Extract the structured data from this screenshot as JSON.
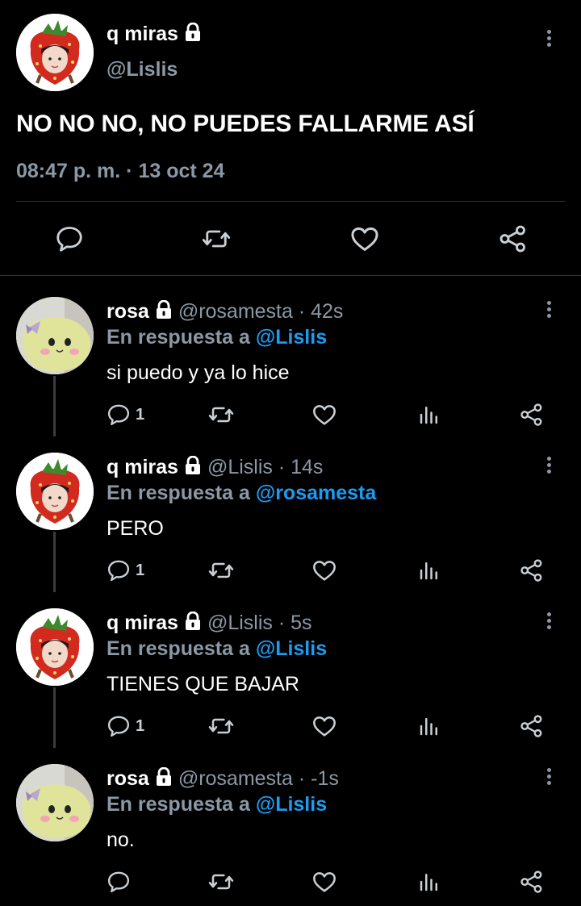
{
  "main_tweet": {
    "name": "q miras",
    "handle": "@Lislis",
    "text": "NO NO NO, NO PUEDES FALLARME ASÍ",
    "timestamp": "08:47 p. m. · 13 oct 24",
    "icons": [
      "lock-icon",
      "more-icon",
      "reply-icon",
      "retweet-icon",
      "like-icon",
      "share-icon"
    ]
  },
  "replies": [
    {
      "name": "rosa",
      "handle": "@rosamesta · 42s",
      "in_reply_label": "En respuesta a",
      "in_reply_to": "@Lislis",
      "text": "si puedo y ya lo hice",
      "reply_count": "1",
      "avatar": "plush"
    },
    {
      "name": "q miras",
      "handle": "@Lislis · 14s",
      "in_reply_label": "En respuesta a",
      "in_reply_to": "@rosamesta",
      "text": "PERO",
      "reply_count": "1",
      "avatar": "strawberry"
    },
    {
      "name": "q miras",
      "handle": "@Lislis · 5s",
      "in_reply_label": "En respuesta a",
      "in_reply_to": "@Lislis",
      "text": "TIENES QUE BAJAR",
      "reply_count": "1",
      "avatar": "strawberry"
    },
    {
      "name": "rosa",
      "handle": "@rosamesta · -1s",
      "in_reply_label": "En respuesta a",
      "in_reply_to": "@Lislis",
      "text": "no.",
      "reply_count": "",
      "avatar": "plush"
    }
  ],
  "colors": {
    "background": "#000000",
    "text": "#e7e9ea",
    "muted": "#8b98a5",
    "link": "#1d9bf0",
    "divider": "#2f3336"
  }
}
